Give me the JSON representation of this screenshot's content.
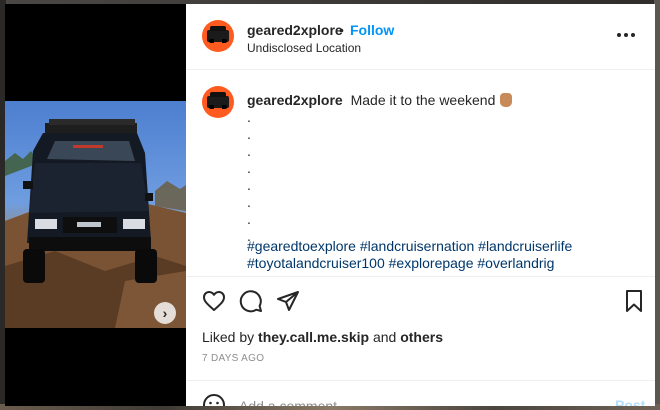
{
  "post": {
    "username": "geared2xplore",
    "separator": "•",
    "follow_label": "Follow",
    "location": "Undisclosed Location",
    "caption_text": "Made it to the weekend",
    "caption_emoji": "sign-of-the-horns-emoji",
    "caption_dots": [
      ".",
      ".",
      ".",
      ".",
      ".",
      ".",
      ".",
      "."
    ],
    "hashtags_line1": "#gearedtoexplore #landcruisernation #landcruiserlife",
    "hashtags_line2": "#toyotalandcruiser100 #explorepage #overlandrig"
  },
  "media": {
    "next_icon": "chevron-right-icon",
    "carousel_dots": 3,
    "active_dot": 0
  },
  "actions": {
    "icons": [
      "heart-icon",
      "comment-icon",
      "share-icon",
      "bookmark-icon"
    ],
    "liked_by_prefix": "Liked by",
    "liked_by_user": "they.call.me.skip",
    "liked_by_and": "and",
    "liked_by_others": "others",
    "timestamp": "7 DAYS AGO"
  },
  "comment": {
    "placeholder": "Add a comment…",
    "post_label": "Post"
  },
  "colors": {
    "follow": "#0095f6",
    "hashtag": "#00376b",
    "avatar_bg": "#ff5a1f",
    "post_disabled": "#b2dffc"
  }
}
